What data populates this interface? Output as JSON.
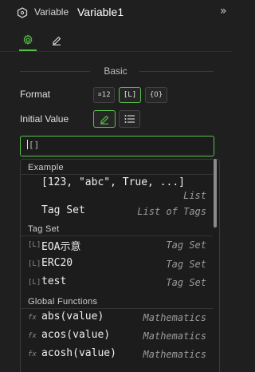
{
  "header": {
    "type_label": "Variable",
    "name": "Variable1",
    "collapse_glyph": "»"
  },
  "tabs": [
    {
      "icon": "gear-icon",
      "active": true
    },
    {
      "icon": "pencil-icon",
      "active": false
    }
  ],
  "section": {
    "title": "Basic"
  },
  "format": {
    "label": "Format",
    "options": [
      {
        "label": "¤12",
        "selected": false
      },
      {
        "label": "[L]",
        "selected": true
      },
      {
        "label": "{O}",
        "selected": false
      }
    ]
  },
  "initial_value": {
    "label": "Initial Value",
    "modes": [
      {
        "icon": "pencil-icon",
        "selected": true
      },
      {
        "icon": "list-icon",
        "selected": false
      }
    ],
    "input_value": "[]"
  },
  "dropdown": {
    "example": {
      "header": "Example",
      "value": "[123, \"abc\", True, ...]",
      "type": "List"
    },
    "tag_set_row": {
      "name": "Tag Set",
      "type": "List of Tags"
    },
    "tag_set": {
      "header": "Tag Set",
      "items": [
        {
          "icon": "[L]",
          "name": "EOA示意",
          "type": "Tag Set"
        },
        {
          "icon": "[L]",
          "name": "ERC20",
          "type": "Tag Set"
        },
        {
          "icon": "[L]",
          "name": "test",
          "type": "Tag Set"
        }
      ]
    },
    "functions": {
      "header": "Global Functions",
      "items": [
        {
          "icon": "fx",
          "name": "abs(value)",
          "type": "Mathematics"
        },
        {
          "icon": "fx",
          "name": "acos(value)",
          "type": "Mathematics"
        },
        {
          "icon": "fx",
          "name": "acosh(value)",
          "type": "Mathematics"
        }
      ]
    }
  },
  "colors": {
    "accent": "#59c24a",
    "background": "#1f1f1f"
  }
}
